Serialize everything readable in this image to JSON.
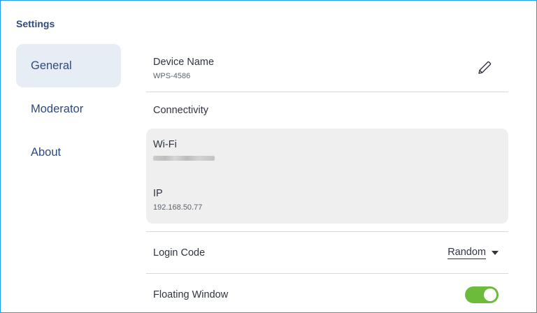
{
  "app": {
    "title": "Settings"
  },
  "sidebar": {
    "items": [
      {
        "label": "General",
        "active": true
      },
      {
        "label": "Moderator",
        "active": false
      },
      {
        "label": "About",
        "active": false
      }
    ]
  },
  "general": {
    "device_name": {
      "label": "Device Name",
      "value": "WPS-4586",
      "edit_icon": "pencil-icon"
    },
    "connectivity": {
      "label": "Connectivity",
      "wifi_label": "Wi-Fi",
      "ip_label": "IP",
      "ip_value": "192.168.50.77"
    },
    "login_code": {
      "label": "Login Code",
      "value": "Random",
      "icon": "caret-down-icon"
    },
    "floating_window": {
      "label": "Floating Window",
      "enabled": true
    }
  },
  "colors": {
    "accent_border": "#1f9ee8",
    "sidebar_text": "#2e4a7d",
    "toggle_on": "#6dbb3b",
    "card_bg": "#efefef"
  }
}
